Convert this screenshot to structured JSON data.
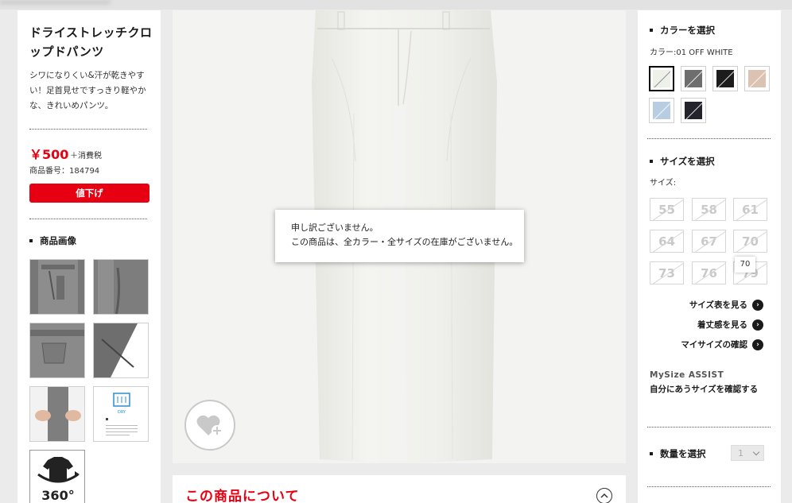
{
  "product": {
    "title": "ドライストレッチクロップドパンツ",
    "description": "シワになりくい&汗が乾きやすい！足首見せですっきり軽やかな、きれいめパンツ。",
    "price": "￥500",
    "tax_label": "＋消費税",
    "code_label": "商品番号：184794",
    "sale_badge": "値下げ"
  },
  "images_section": {
    "heading": "商品画像",
    "thumbnails": [
      {
        "icon": "pants-waist-detail"
      },
      {
        "icon": "pants-pocket-detail"
      },
      {
        "icon": "pants-back-pocket"
      },
      {
        "icon": "pants-hem-detail"
      },
      {
        "icon": "pants-stretch-hands"
      },
      {
        "icon": "dry-tag-icon",
        "label": "DRY"
      },
      {
        "icon": "view-360-icon",
        "label": "360°"
      }
    ]
  },
  "main": {
    "notice_line1": "申し訳ございません。",
    "notice_line2": "この商品は、全カラー・全サイズの在庫がございません。",
    "about_title": "この商品について"
  },
  "color_section": {
    "heading": "カラーを選択",
    "selected_label": "カラー:01 OFF WHITE",
    "swatches": [
      {
        "name": "off-white",
        "color": "#eef0ea",
        "selected": true
      },
      {
        "name": "gray",
        "color": "#6e6e6e",
        "selected": false
      },
      {
        "name": "black",
        "color": "#1c1c1c",
        "selected": false
      },
      {
        "name": "beige",
        "color": "#dcc2b0",
        "selected": false
      },
      {
        "name": "light-blue",
        "color": "#b8cde2",
        "selected": false
      },
      {
        "name": "navy",
        "color": "#23242b",
        "selected": false
      }
    ]
  },
  "size_section": {
    "heading": "サイズを選択",
    "size_label": "サイズ:",
    "sizes": [
      "55",
      "58",
      "61",
      "64",
      "67",
      "70",
      "73",
      "76",
      "79"
    ],
    "tooltip": "70",
    "links": [
      "サイズ表を見る",
      "着丈感を見る",
      "マイサイズの確認"
    ]
  },
  "mysize": {
    "logo": "MySize ASSIST",
    "text": "自分にあうサイズを確認する"
  },
  "quantity": {
    "heading": "数量を選択",
    "value": "1"
  },
  "colors": {
    "accent": "#e60012"
  }
}
